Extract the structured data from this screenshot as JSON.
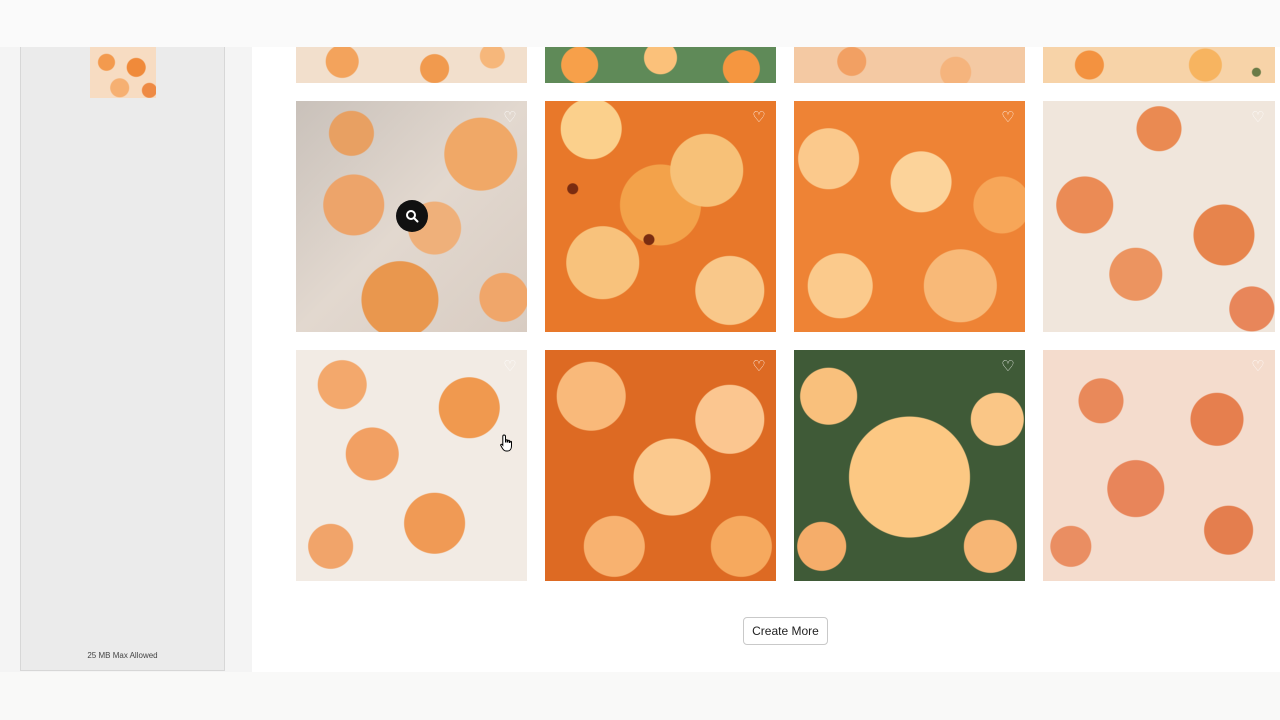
{
  "upload_panel": {
    "max_size_label": "25 MB Max Allowed"
  },
  "gallery": {
    "favorite_icon": "♡",
    "tiles": [
      {
        "row": "partial-top",
        "pattern": "orange-daisies-cream",
        "has_favorite": false
      },
      {
        "row": "partial-top",
        "pattern": "orange-daisies-green",
        "has_favorite": false
      },
      {
        "row": "partial-top",
        "pattern": "peach-daisies",
        "has_favorite": false
      },
      {
        "row": "partial-top",
        "pattern": "orange-yellow-daisies",
        "has_favorite": false
      },
      {
        "row": 1,
        "pattern": "muted-orange-daisies-grey",
        "has_favorite": true,
        "hovered": true
      },
      {
        "row": 1,
        "pattern": "bright-orange-daisies",
        "has_favorite": true
      },
      {
        "row": 1,
        "pattern": "orange-daisies-dense",
        "has_favorite": true
      },
      {
        "row": 1,
        "pattern": "coral-daisies-white",
        "has_favorite": true
      },
      {
        "row": 2,
        "pattern": "peach-daisies-white",
        "has_favorite": true
      },
      {
        "row": 2,
        "pattern": "burnt-orange-daisies",
        "has_favorite": true
      },
      {
        "row": 2,
        "pattern": "large-orange-daisy-green",
        "has_favorite": true
      },
      {
        "row": 2,
        "pattern": "coral-daisies-blush",
        "has_favorite": true
      }
    ]
  },
  "actions": {
    "create_more_label": "Create More"
  },
  "colors": {
    "page_background": "#f7f7f6",
    "panel_background": "#ebebeb",
    "button_border": "#c9c9c9",
    "zoom_button": "#111111"
  },
  "icons": {
    "favorite": "heart-outline-icon",
    "zoom": "magnifier-icon",
    "cursor": "hand-pointer-icon"
  }
}
